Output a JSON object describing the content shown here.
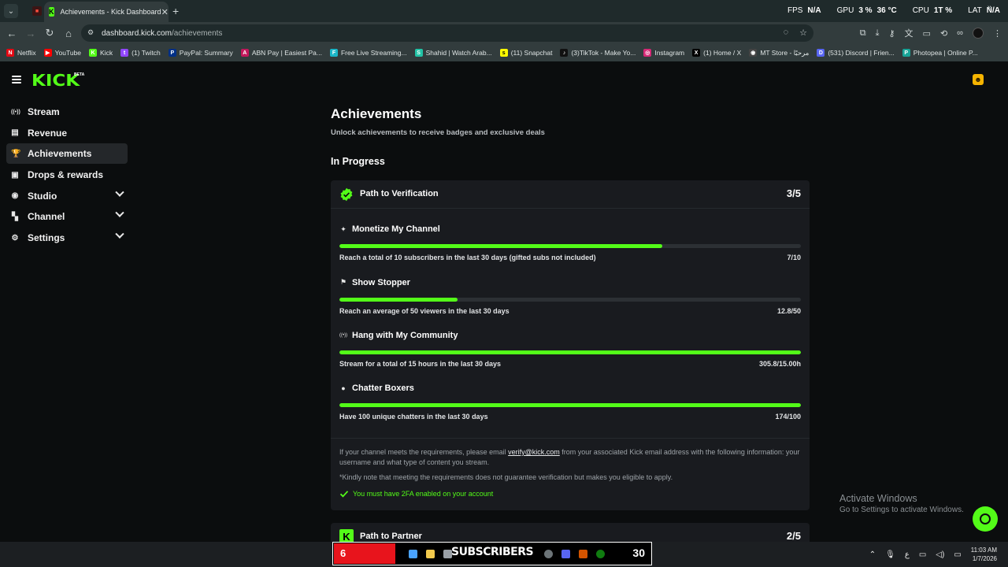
{
  "browser": {
    "tab_title": "Achievements - Kick Dashboard",
    "url_host": "dashboard.kick.com",
    "url_path": "/achievements",
    "perf": [
      {
        "label": "FPS",
        "value": "N/A"
      },
      {
        "label": "GPU",
        "value": "3 %"
      },
      {
        "label": "",
        "value": "36 °C"
      },
      {
        "label": "CPU",
        "value": "1T %"
      },
      {
        "label": "LAT",
        "value": "N/A"
      }
    ],
    "bookmarks": [
      {
        "label": "Netflix",
        "color": "#e50914",
        "icon": "N"
      },
      {
        "label": "YouTube",
        "color": "#ff0000",
        "icon": "▶"
      },
      {
        "label": "Kick",
        "color": "#53fc18",
        "icon": "K"
      },
      {
        "label": "(1) Twitch",
        "color": "#9146ff",
        "icon": "t"
      },
      {
        "label": "PayPal: Summary",
        "color": "#003087",
        "icon": "P"
      },
      {
        "label": "ABN Pay | Easiest Pa...",
        "color": "#c2185b",
        "icon": "A"
      },
      {
        "label": "Free Live Streaming...",
        "color": "#1bb6c8",
        "icon": "F"
      },
      {
        "label": "Shahid | Watch Arab...",
        "color": "#22c3a6",
        "icon": "S"
      },
      {
        "label": "(11) Snapchat",
        "color": "#fffc00",
        "icon": "s"
      },
      {
        "label": "(3)TikTok - Make Yo...",
        "color": "#111111",
        "icon": "♪"
      },
      {
        "label": "Instagram",
        "color": "#d62976",
        "icon": "◎"
      },
      {
        "label": "(1) Home / X",
        "color": "#000000",
        "icon": "X"
      },
      {
        "label": "MT Store - مرحبًا",
        "color": "#444444",
        "icon": "◉"
      },
      {
        "label": "(531) Discord | Frien...",
        "color": "#5865f2",
        "icon": "D"
      },
      {
        "label": "Photopea | Online P...",
        "color": "#18a497",
        "icon": "P"
      }
    ]
  },
  "app": {
    "logo": "KICK",
    "logo_badge": "BETA",
    "nav": [
      {
        "label": "Stream",
        "icon": "broadcast-icon",
        "glyph": "((•))",
        "expand": false,
        "active": false
      },
      {
        "label": "Revenue",
        "icon": "revenue-icon",
        "glyph": "▤",
        "expand": false,
        "active": false
      },
      {
        "label": "Achievements",
        "icon": "trophy-icon",
        "glyph": "🏆",
        "expand": false,
        "active": true
      },
      {
        "label": "Drops & rewards",
        "icon": "gift-icon",
        "glyph": "▣",
        "expand": false,
        "active": false
      },
      {
        "label": "Studio",
        "icon": "studio-icon",
        "glyph": "◉",
        "expand": true,
        "active": false
      },
      {
        "label": "Channel",
        "icon": "channel-icon",
        "glyph": "▚",
        "expand": true,
        "active": false
      },
      {
        "label": "Settings",
        "icon": "gear-icon",
        "glyph": "⚙",
        "expand": true,
        "active": false
      }
    ]
  },
  "page": {
    "title": "Achievements",
    "subtitle": "Unlock achievements to receive badges and exclusive deals",
    "section": "In Progress",
    "verification": {
      "title": "Path to Verification",
      "count": "3/5",
      "achievements": [
        {
          "name": "Monetize My Channel",
          "glyph": "✦",
          "icon": "sparkle-icon",
          "description": "Reach a total of 10 subscribers in the last 30 days (gifted subs not included)",
          "progress": "7/10",
          "fraction": 0.7
        },
        {
          "name": "Show Stopper",
          "glyph": "⚑",
          "icon": "users-icon",
          "description": "Reach an average of 50 viewers in the last 30 days",
          "progress": "12.8/50",
          "fraction": 0.256
        },
        {
          "name": "Hang with My Community",
          "glyph": "((•))",
          "icon": "broadcast-icon",
          "description": "Stream for a total of 15 hours in the last 30 days",
          "progress": "305.8/15.00h",
          "fraction": 1.0
        },
        {
          "name": "Chatter Boxers",
          "glyph": "●",
          "icon": "chat-icon",
          "description": "Have 100 unique chatters in the last 30 days",
          "progress": "174/100",
          "fraction": 1.0
        }
      ],
      "note_before": "If your channel meets the requirements, please email ",
      "note_email": "verify@kick.com",
      "note_after": " from your associated Kick email address with the following information: your username and what type of content you stream.",
      "note2": "*Kindly note that meeting the requirements does not guarantee verification but makes you eligible to apply.",
      "requirement": "You must have 2FA enabled on your account"
    },
    "partner": {
      "title": "Path to Partner",
      "count": "2/5"
    }
  },
  "windows": {
    "activate_title": "Activate Windows",
    "activate_sub": "Go to Settings to activate Windows."
  },
  "taskbar": {
    "widget_left": "6",
    "widget_label": "SUBSCRIBERS",
    "widget_right": "30",
    "lang": "ع",
    "time": "11:03 AM",
    "date": "1/7/2026"
  },
  "colors": {
    "accent": "#53fc18",
    "card": "#191b1f",
    "background": "#0b0d0e"
  }
}
